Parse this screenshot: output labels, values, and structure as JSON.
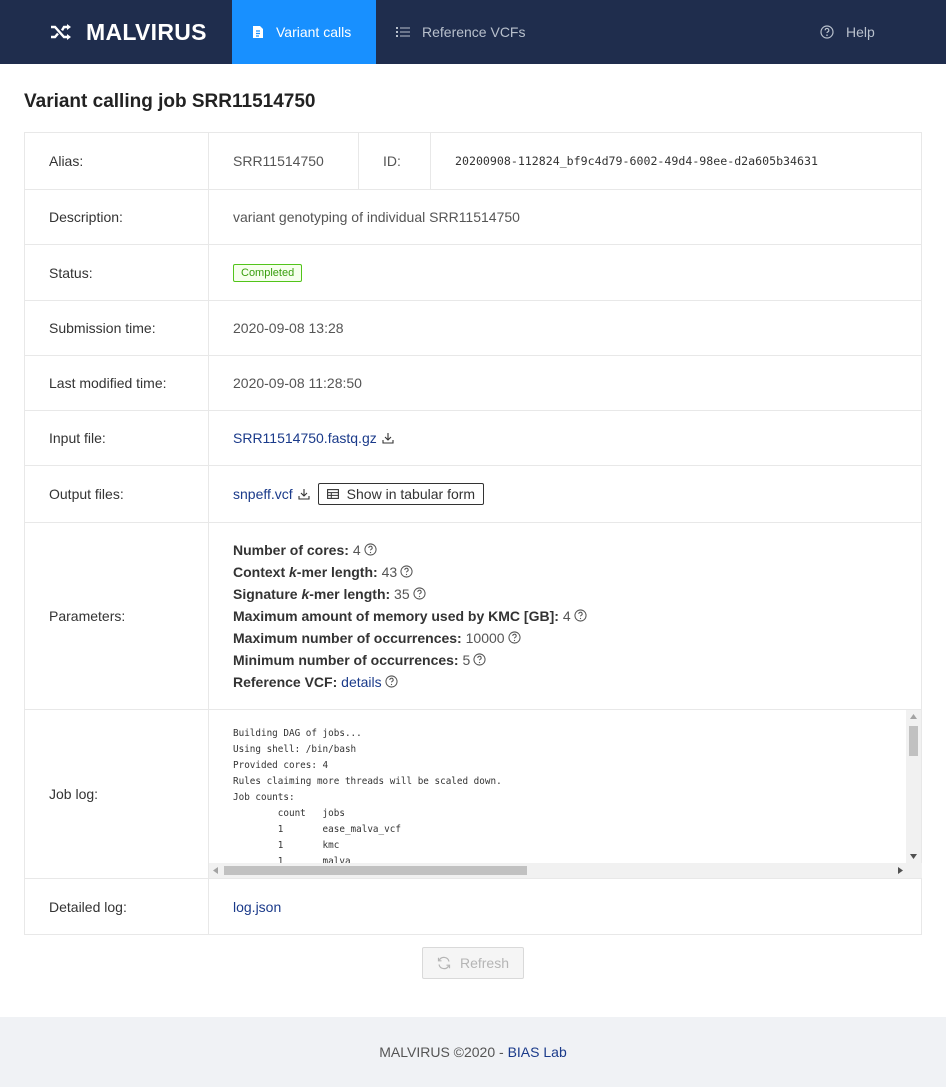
{
  "nav": {
    "brand": "MALVIRUS",
    "items": [
      {
        "label": "Variant calls",
        "icon": "file-icon",
        "active": true
      },
      {
        "label": "Reference VCFs",
        "icon": "list-icon",
        "active": false
      }
    ],
    "help": "Help"
  },
  "page": {
    "title_prefix": "Variant calling job ",
    "title_job": "SRR11514750"
  },
  "details": {
    "alias_label": "Alias:",
    "alias": "SRR11514750",
    "id_label": "ID:",
    "id": "20200908-112824_bf9c4d79-6002-49d4-98ee-d2a605b34631",
    "description_label": "Description:",
    "description": "variant genotyping of individual SRR11514750",
    "status_label": "Status:",
    "status": "Completed",
    "submission_label": "Submission time:",
    "submission": "2020-09-08 13:28",
    "modified_label": "Last modified time:",
    "modified": "2020-09-08 11:28:50",
    "input_label": "Input file:",
    "input_file": "SRR11514750.fastq.gz",
    "output_label": "Output files:",
    "output_file": "snpeff.vcf",
    "tabular_button": "Show in tabular form",
    "parameters_label": "Parameters:",
    "joblog_label": "Job log:",
    "detailed_label": "Detailed log:",
    "detailed_log": "log.json"
  },
  "params": [
    {
      "label": "Number of cores:",
      "value": "4"
    },
    {
      "label_pre": "Context ",
      "label_k": "k",
      "label_post": "-mer length:",
      "value": "43"
    },
    {
      "label_pre": "Signature ",
      "label_k": "k",
      "label_post": "-mer length:",
      "value": "35"
    },
    {
      "label": "Maximum amount of memory used by KMC [GB]:",
      "value": "4"
    },
    {
      "label": "Maximum number of occurrences:",
      "value": "10000"
    },
    {
      "label": "Minimum number of occurrences:",
      "value": "5"
    },
    {
      "label": "Reference VCF:",
      "link": "details"
    }
  ],
  "job_log": "Building DAG of jobs...\nUsing shell: /bin/bash\nProvided cores: 4\nRules claiming more threads will be scaled down.\nJob counts:\n        count   jobs\n        1       ease_malva_vcf\n        1       kmc\n        1       malva",
  "refresh_button": "Refresh",
  "footer": {
    "text": "MALVIRUS ©2020 - ",
    "link": "BIAS Lab"
  }
}
